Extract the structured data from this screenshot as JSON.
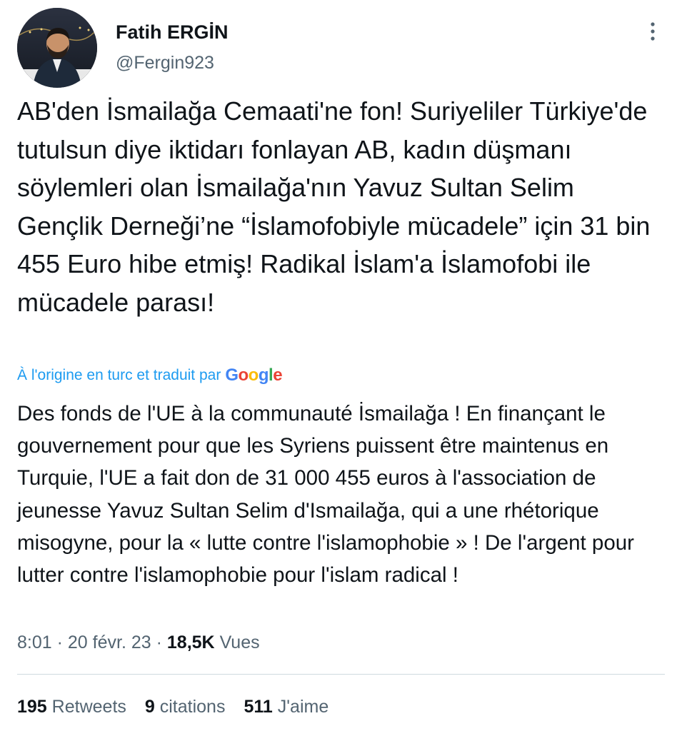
{
  "author": {
    "display_name": "Fatih ERGİN",
    "handle": "@Fergin923"
  },
  "tweet": {
    "text": "AB'den İsmailağa Cemaati'ne fon! Suriyeliler Türkiye'de tutulsun diye iktidarı fonlayan AB, kadın düşmanı söylemleri olan İsmailağa'nın Yavuz Sultan Selim Gençlik Derneği’ne “İslamofobiyle mücadele” için 31 bin 455 Euro hibe etmiş! Radikal İslam'a İslamofobi ile mücadele parası!"
  },
  "translation": {
    "label": "À l'origine en turc et traduit par",
    "provider_letters": [
      "G",
      "o",
      "o",
      "g",
      "l",
      "e"
    ],
    "text": "Des fonds de l'UE à la communauté İsmailağa ! En finançant le gouvernement pour que les Syriens puissent être maintenus en Turquie, l'UE a fait don de 31 000 455 euros à l'association de jeunesse Yavuz Sultan Selim d'Ismailağa, qui a une rhétorique misogyne, pour la « lutte contre l'islamophobie » ! De l'argent pour lutter contre l'islamophobie pour l'islam radical !"
  },
  "meta": {
    "time": "8:01",
    "date": "20 févr. 23",
    "separator": "·",
    "views_count": "18,5K",
    "views_label": "Vues"
  },
  "stats": {
    "retweets_count": "195",
    "retweets_label": "Retweets",
    "quotes_count": "9",
    "quotes_label": "citations",
    "likes_count": "511",
    "likes_label": "J'aime"
  },
  "icons": {
    "more": "more-vertical-icon",
    "avatar": "avatar-photo"
  },
  "colors": {
    "text_primary": "#0f1419",
    "text_secondary": "#536471",
    "accent": "#1d9bf0",
    "divider": "#cfd9de"
  }
}
